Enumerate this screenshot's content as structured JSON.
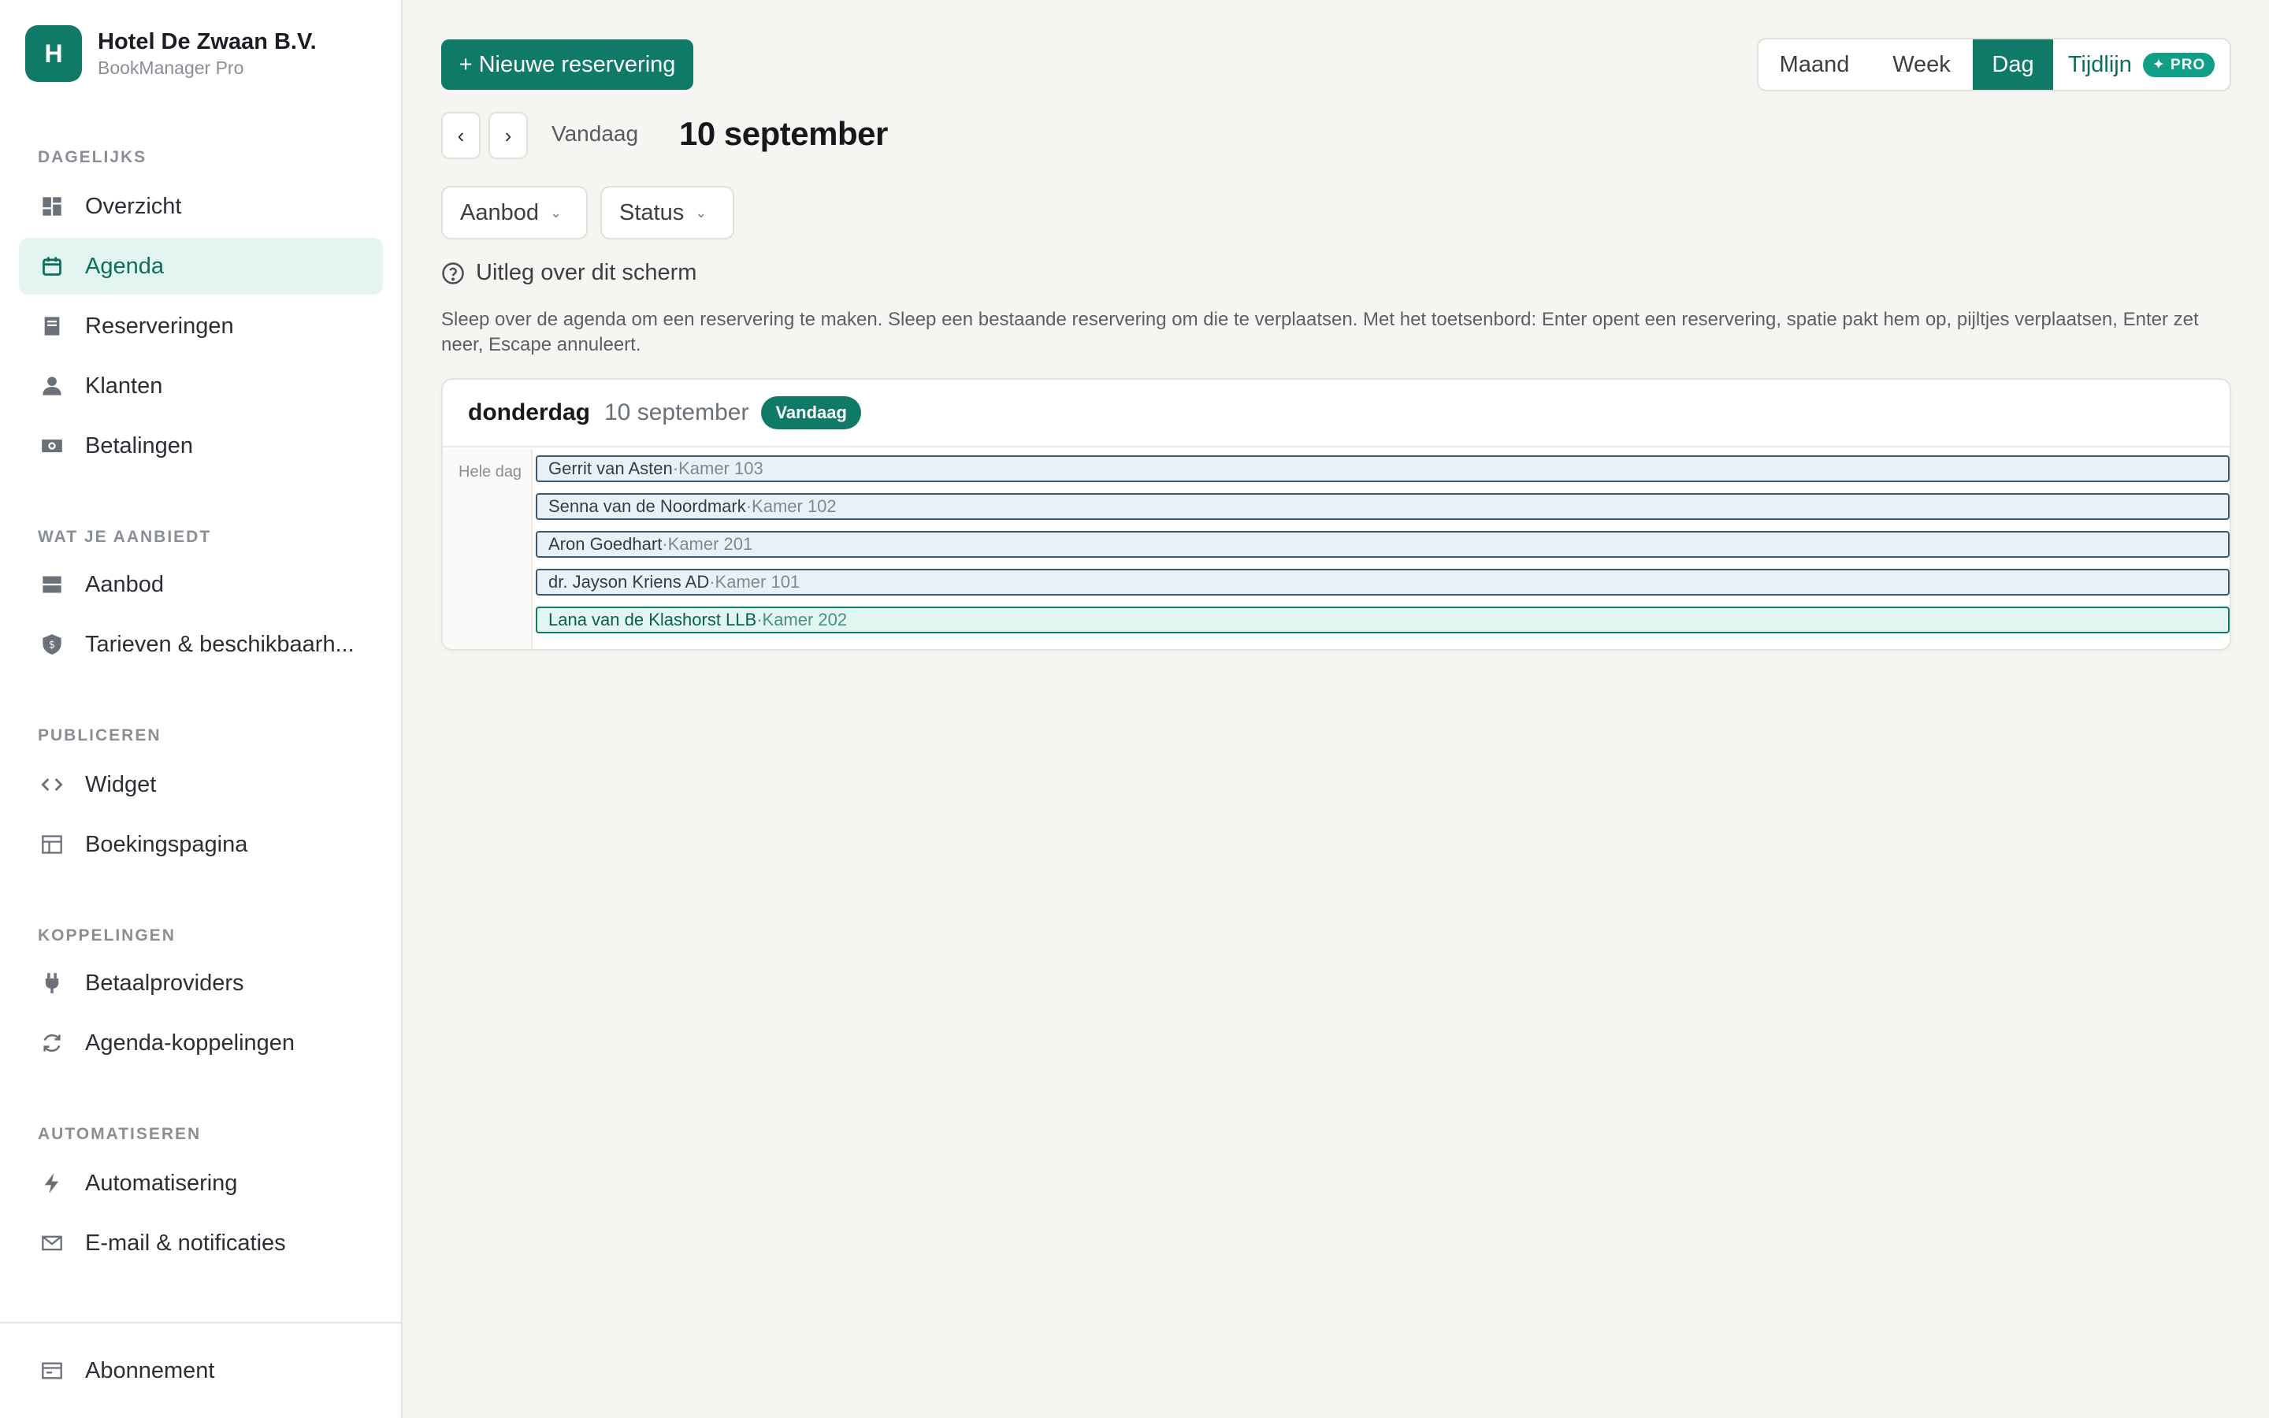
{
  "brand": {
    "initial": "H",
    "name": "Hotel De Zwaan B.V.",
    "product": "BookManager Pro"
  },
  "sidebar": {
    "sections": [
      {
        "label": "DAGELIJKS"
      },
      {
        "label": "WAT JE AANBIEDT"
      },
      {
        "label": "PUBLICEREN"
      },
      {
        "label": "KOPPELINGEN"
      },
      {
        "label": "AUTOMATISEREN"
      }
    ],
    "items": [
      {
        "label": "Overzicht",
        "icon": "dashboard-icon"
      },
      {
        "label": "Agenda",
        "icon": "calendar-icon",
        "active": true
      },
      {
        "label": "Reserveringen",
        "icon": "document-icon"
      },
      {
        "label": "Klanten",
        "icon": "user-icon"
      },
      {
        "label": "Betalingen",
        "icon": "payment-icon"
      },
      {
        "label": "Aanbod",
        "icon": "stack-icon"
      },
      {
        "label": "Tarieven & beschikbaarh...",
        "icon": "shield-icon"
      },
      {
        "label": "Widget",
        "icon": "code-icon"
      },
      {
        "label": "Boekingspagina",
        "icon": "layout-icon"
      },
      {
        "label": "Betaalproviders",
        "icon": "plug-icon"
      },
      {
        "label": "Agenda-koppelingen",
        "icon": "sync-icon"
      },
      {
        "label": "Automatisering",
        "icon": "bolt-icon"
      },
      {
        "label": "E-mail & notificaties",
        "icon": "mail-icon"
      }
    ],
    "footer": {
      "label": "Abonnement",
      "icon": "subscription-icon"
    }
  },
  "toolbar": {
    "new_label": "+ Nieuwe reservering",
    "views": {
      "month": "Maand",
      "week": "Week",
      "day": "Dag",
      "timeline": "Tijdlijn",
      "pro": "✦ PRO"
    },
    "prev": "‹",
    "next": "›",
    "today": "Vandaag",
    "current_date": "10 september"
  },
  "filters": {
    "offer": "Aanbod",
    "status": "Status",
    "chevron": "⌄"
  },
  "help": {
    "title": "Uitleg over dit scherm",
    "description": "Sleep over de agenda om een reservering te maken. Sleep een bestaande reservering om die te verplaatsen. Met het toetsenbord: Enter opent een reservering, spatie pakt hem op, pijltjes verplaatsen, Enter zet neer, Escape annuleert."
  },
  "day": {
    "weekday": "donderdag",
    "date": "10 september",
    "today_badge": "Vandaag",
    "allday_label": "Hele dag",
    "events": [
      {
        "guest": "Gerrit van Asten",
        "sep": " · ",
        "room": "Kamer 103"
      },
      {
        "guest": "Senna van de Noordmark",
        "sep": " · ",
        "room": "Kamer 102"
      },
      {
        "guest": "Aron Goedhart",
        "sep": " · ",
        "room": "Kamer 201"
      },
      {
        "guest": "dr. Jayson Kriens AD",
        "sep": " · ",
        "room": "Kamer 101"
      },
      {
        "guest": "Lana van de Klashorst LLB",
        "sep": " · ",
        "room": "Kamer 202"
      }
    ]
  },
  "colors": {
    "accent": "#0f7a68",
    "accent_soft": "#e3f5f0",
    "event_border": "#3d5a73"
  }
}
